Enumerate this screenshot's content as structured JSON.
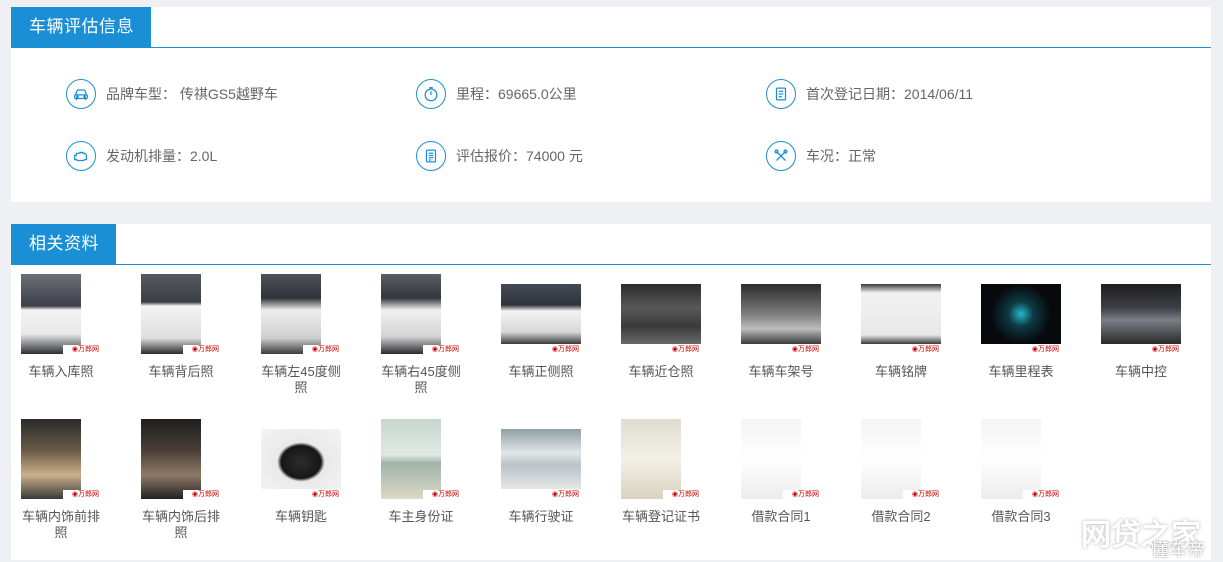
{
  "eval": {
    "title": "车辆评估信息",
    "items": [
      {
        "label": "品牌车型：  传祺GS5越野车",
        "icon": "car-icon"
      },
      {
        "label": "里程：69665.0公里",
        "icon": "gauge-icon"
      },
      {
        "label": "首次登记日期：2014/06/11",
        "icon": "document-icon"
      },
      {
        "label": "发动机排量：2.0L",
        "icon": "engine-icon"
      },
      {
        "label": "评估报价：74000 元",
        "icon": "quote-icon"
      },
      {
        "label": "车况：正常",
        "icon": "tools-icon"
      }
    ]
  },
  "docs": {
    "title": "相关资料",
    "watermark_text": "万郎网",
    "items": [
      {
        "label": "车辆入库照"
      },
      {
        "label": "车辆背后照"
      },
      {
        "label": "车辆左45度侧照"
      },
      {
        "label": "车辆右45度侧照"
      },
      {
        "label": "车辆正侧照"
      },
      {
        "label": "车辆近仓照"
      },
      {
        "label": "车辆车架号"
      },
      {
        "label": "车辆铭牌"
      },
      {
        "label": "车辆里程表"
      },
      {
        "label": "车辆中控"
      },
      {
        "label": "车辆内饰前排照"
      },
      {
        "label": "车辆内饰后排照"
      },
      {
        "label": "车辆钥匙"
      },
      {
        "label": "车主身份证"
      },
      {
        "label": "车辆行驶证"
      },
      {
        "label": "车辆登记证书"
      },
      {
        "label": "借款合同1"
      },
      {
        "label": "借款合同2"
      },
      {
        "label": "借款合同3"
      }
    ]
  },
  "site_watermark": {
    "line1": "网贷之家",
    "line2": "懂车帝"
  }
}
